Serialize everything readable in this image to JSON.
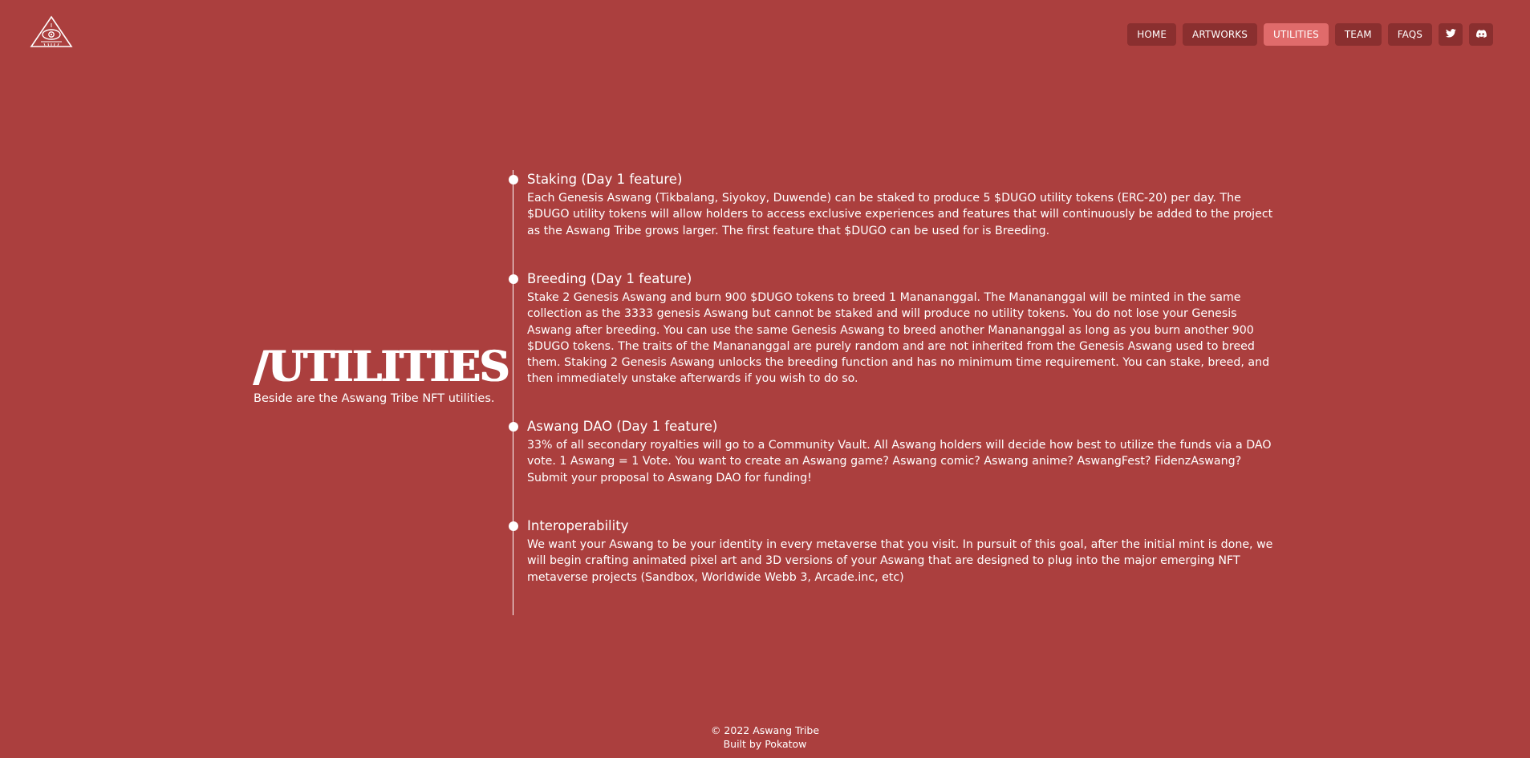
{
  "nav": {
    "items": [
      {
        "label": "HOME",
        "active": false
      },
      {
        "label": "ARTWORKS",
        "active": false
      },
      {
        "label": "UTILITIES",
        "active": true
      },
      {
        "label": "TEAM",
        "active": false
      },
      {
        "label": "FAQS",
        "active": false
      }
    ],
    "social": [
      {
        "icon": "twitter-icon"
      },
      {
        "icon": "discord-icon"
      }
    ]
  },
  "logo": {
    "icon": "all-seeing-eye-triangle-logo"
  },
  "heading": {
    "title": "/UTILITIES",
    "subtitle": "Beside are the Aswang Tribe NFT utilities."
  },
  "timeline": [
    {
      "title": "Staking (Day 1 feature)",
      "text": "Each Genesis Aswang (Tikbalang, Siyokoy, Duwende) can be staked to produce 5 $DUGO utility tokens (ERC-20) per day. The $DUGO utility tokens will allow holders to access exclusive experiences and features that will continuously be added to the project as the Aswang Tribe grows larger. The first feature that $DUGO can be used for is Breeding."
    },
    {
      "title": "Breeding (Day 1 feature)",
      "text": "Stake 2 Genesis Aswang and burn 900 $DUGO tokens to breed 1 Manananggal. The Manananggal will be minted in the same collection as the 3333 genesis Aswang but cannot be staked and will produce no utility tokens. You do not lose your Genesis Aswang after breeding. You can use the same Genesis Aswang to breed another Manananggal as long as you burn another 900 $DUGO tokens. The traits of the Manananggal are purely random and are not inherited from the Genesis Aswang used to breed them. Staking 2 Genesis Aswang unlocks the breeding function and has no minimum time requirement. You can stake, breed, and then immediately unstake afterwards if you wish to do so."
    },
    {
      "title": "Aswang DAO (Day 1 feature)",
      "text": "33% of all secondary royalties will go to a Community Vault. All Aswang holders will decide how best to utilize the funds via a DAO vote. 1 Aswang = 1 Vote. You want to create an Aswang game? Aswang comic? Aswang anime? AswangFest? FidenzAswang? Submit your proposal to Aswang DAO for funding!"
    },
    {
      "title": "Interoperability",
      "text": "We want your Aswang to be your identity in every metaverse that you visit. In pursuit of this goal, after the initial mint is done, we will begin crafting animated pixel art and 3D versions of your Aswang that are designed to plug into the major emerging NFT metaverse projects (Sandbox, Worldwide Webb 3, Arcade.inc, etc)"
    }
  ],
  "footer": {
    "copyright": "© 2022 Aswang Tribe",
    "credit": "Built by Pokatow"
  },
  "colors": {
    "background": "#ab3f3e",
    "nav_button": "#8a2f2f",
    "nav_active": "#e06b6b",
    "text": "#ffffff"
  }
}
